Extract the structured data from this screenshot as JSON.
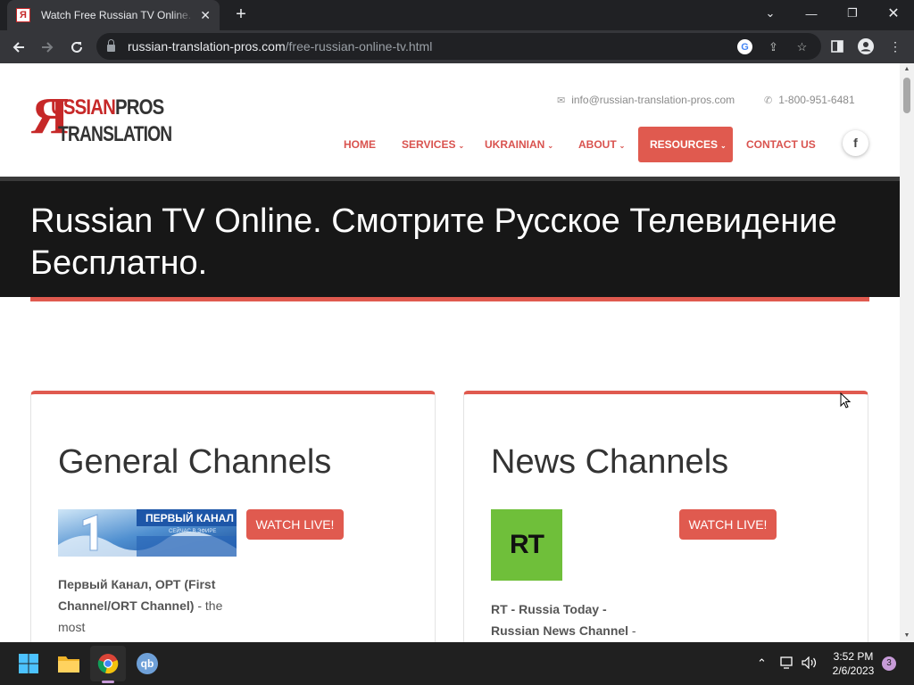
{
  "browser": {
    "tab_title": "Watch Free Russian TV Online. Смотрите",
    "favicon_letter": "Я",
    "url_domain": "russian-translation-pros.com",
    "url_path": "/free-russian-online-tv.html",
    "new_tab_icon": "plus-icon",
    "minimize_icon": "chevron-down-icon"
  },
  "site": {
    "logo": {
      "ya": "Я",
      "line1_red": "USSIAN",
      "line1_dark": "PROS",
      "line2": "TRANSLATION"
    },
    "email": "info@russian-translation-pros.com",
    "phone": "1-800-951-6481",
    "nav": [
      {
        "label": "HOME"
      },
      {
        "label": "SERVICES"
      },
      {
        "label": "UKRAINIAN"
      },
      {
        "label": "ABOUT"
      },
      {
        "label": "RESOURCES"
      },
      {
        "label": "CONTACT US"
      }
    ],
    "facebook": "f",
    "accent_color": "#e05a4f"
  },
  "hero": {
    "title": "Russian TV Online. Смотрите Русское Телевидение Бесплатно."
  },
  "cards": [
    {
      "title": "General Channels",
      "watch_label": "WATCH LIVE!",
      "thumb_text": "ПЕРВЫЙ КАНАЛ",
      "thumb_sub": "СЕЙЧАС В ЭФИРЕ",
      "desc_bold": "Первый Канал, ОРТ (First Channel/ORT Channel)",
      "desc_rest": " - the most"
    },
    {
      "title": "News Channels",
      "watch_label": "WATCH LIVE!",
      "thumb_text": "RT",
      "desc_bold": "RT - Russia Today - Russian News Channel",
      "desc_rest": " -"
    }
  ],
  "taskbar": {
    "time": "3:52 PM",
    "date": "2/6/2023",
    "notifications": "3",
    "qb_label": "qb"
  }
}
